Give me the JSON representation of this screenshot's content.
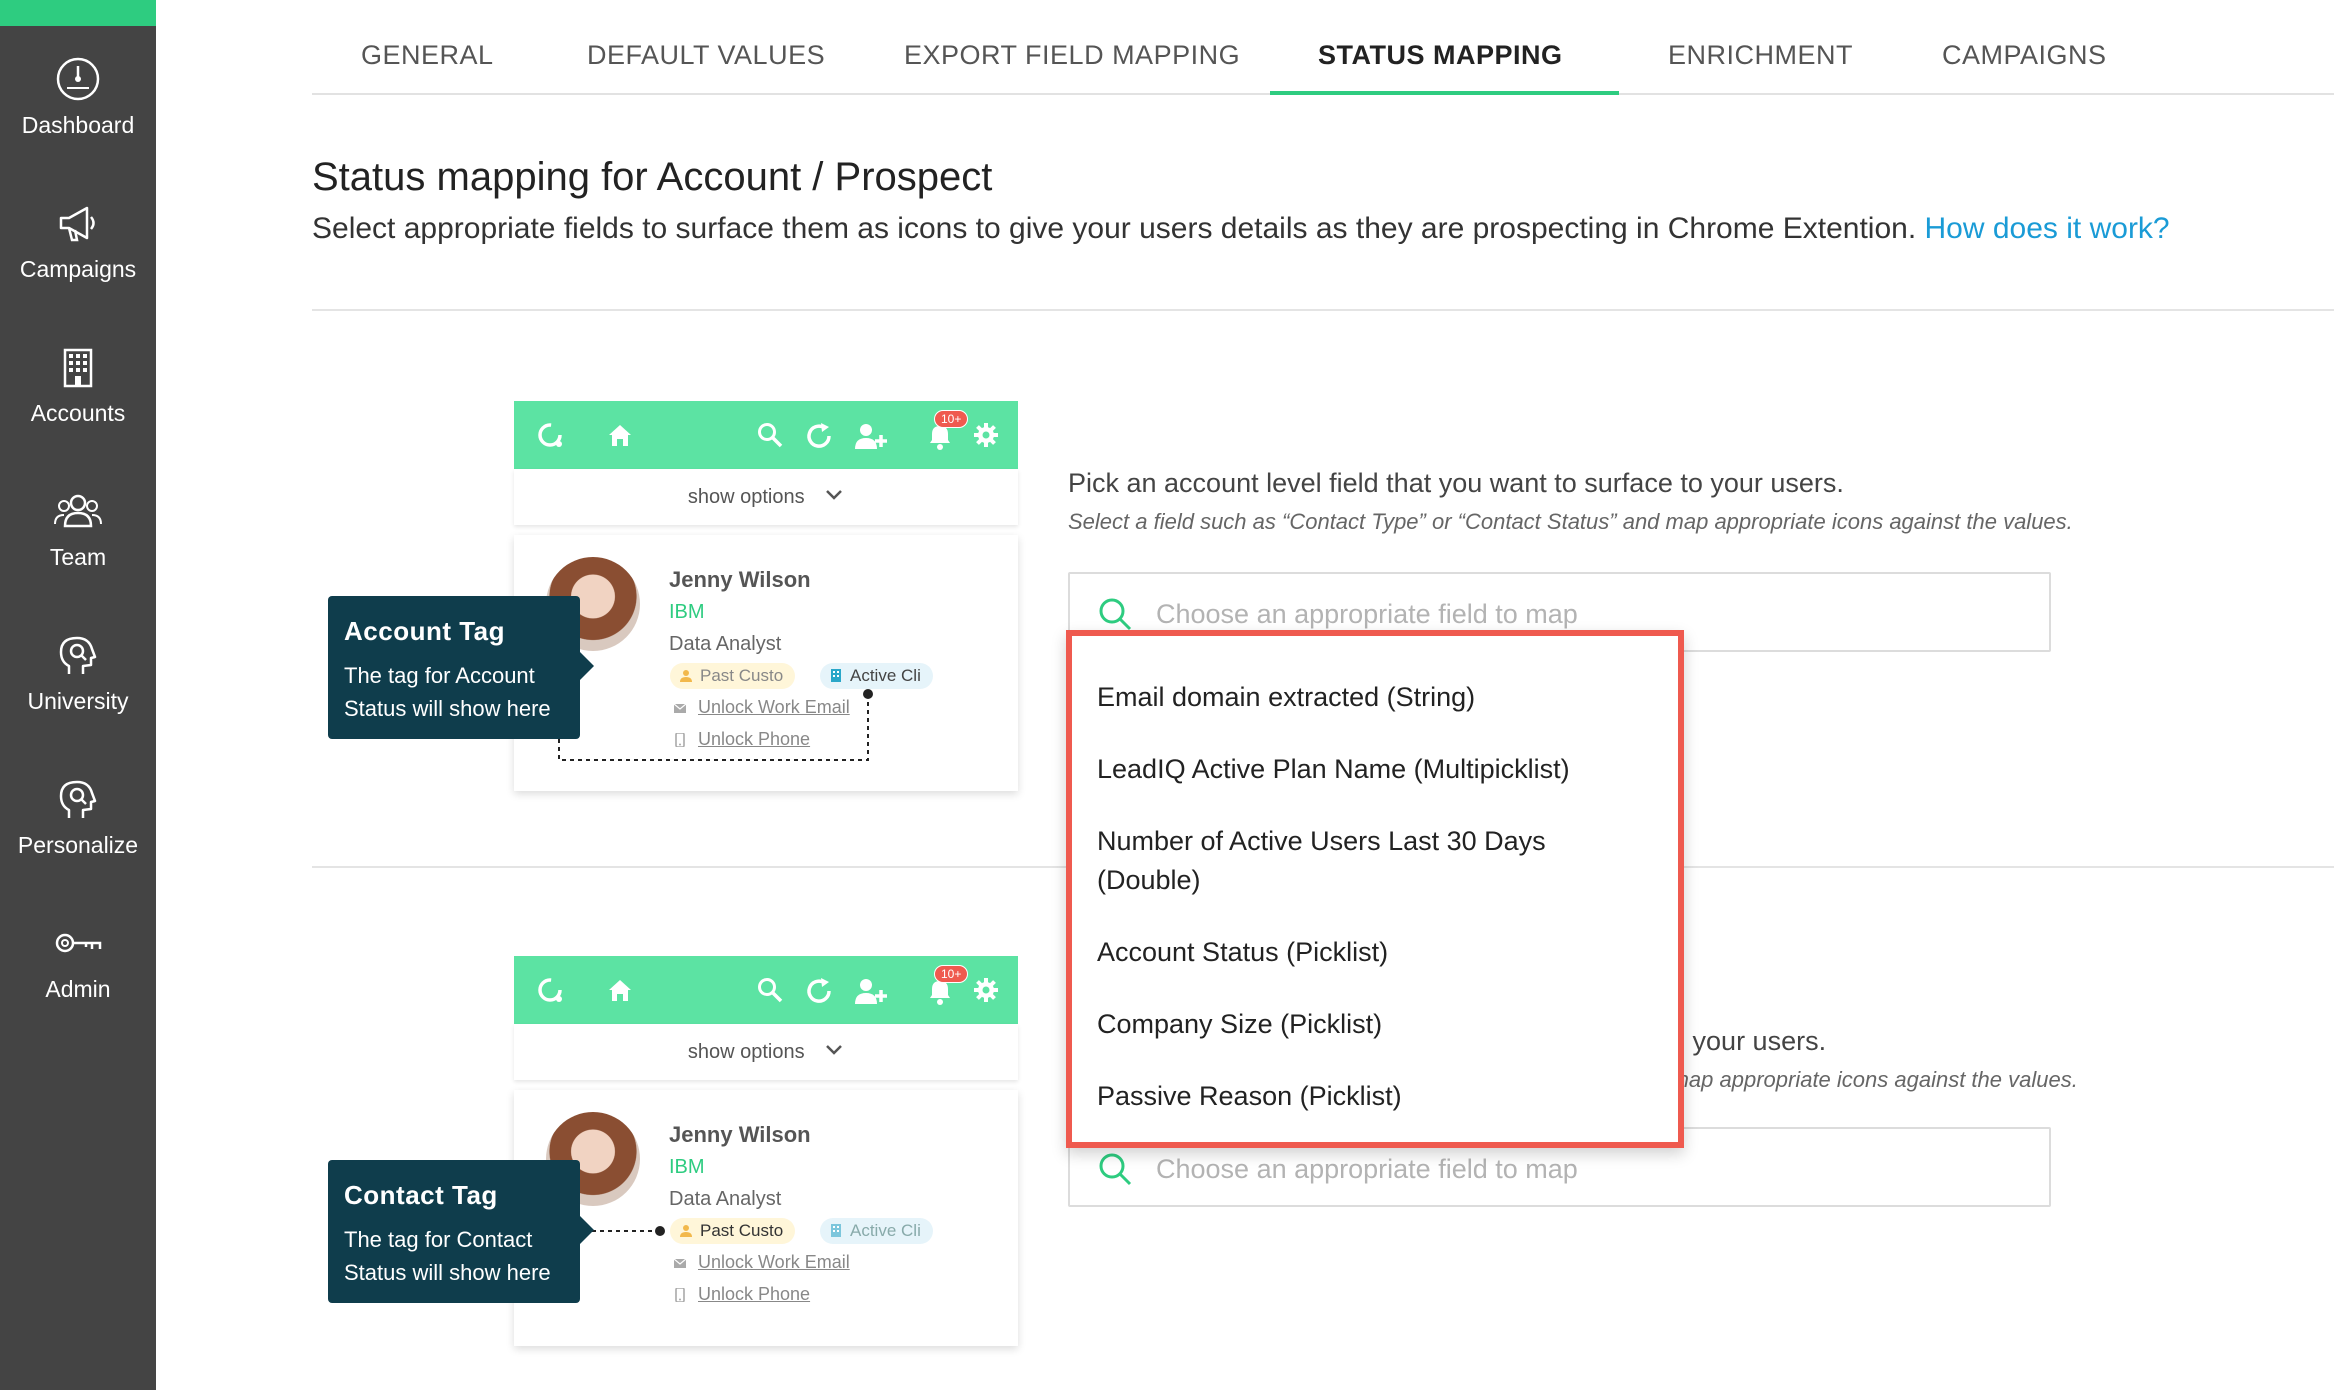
{
  "sidebar": {
    "items": [
      {
        "label": "Dashboard",
        "icon": "dashboard-gauge-icon"
      },
      {
        "label": "Campaigns",
        "icon": "megaphone-icon"
      },
      {
        "label": "Accounts",
        "icon": "building-icon"
      },
      {
        "label": "Team",
        "icon": "people-icon"
      },
      {
        "label": "University",
        "icon": "head-search-icon"
      },
      {
        "label": "Personalize",
        "icon": "head-search-icon"
      },
      {
        "label": "Admin",
        "icon": "key-icon"
      }
    ]
  },
  "tabs": [
    {
      "label": "GENERAL"
    },
    {
      "label": "DEFAULT VALUES"
    },
    {
      "label": "EXPORT FIELD MAPPING"
    },
    {
      "label": "STATUS MAPPING",
      "active": true
    },
    {
      "label": "ENRICHMENT"
    },
    {
      "label": "CAMPAIGNS"
    }
  ],
  "page": {
    "title": "Status mapping for Account / Prospect",
    "description": "Select appropriate fields to surface them as icons to give your users details as they are prospecting in Chrome Extention.",
    "help_link": "How does it work?"
  },
  "preview": {
    "show_options": "show options",
    "badge": "10+",
    "name": "Jenny Wilson",
    "company": "IBM",
    "job_title": "Data Analyst",
    "tag_past": "Past Custo",
    "tag_active": "Active Cli",
    "unlock_email": "Unlock Work Email",
    "unlock_phone": "Unlock Phone"
  },
  "account_section": {
    "callout_title": "Account Tag",
    "callout_body": "The tag for Account Status will show here",
    "instruction": "Pick an account level field that you want to surface to your users.",
    "hint": "Select a field such as “Contact Type” or “Contact Status” and map appropriate icons against the values.",
    "placeholder": "Choose an appropriate field to map"
  },
  "contact_section": {
    "callout_title": "Contact Tag",
    "callout_body": "The tag for Contact Status will show here",
    "instruction_partial": "e to your users.",
    "hint_partial": "nd map appropriate icons against the values.",
    "placeholder": "Choose an appropriate field to map"
  },
  "dropdown": {
    "options": [
      "Email domain extracted (String)",
      "LeadIQ Active Plan Name (Multipicklist)",
      "Number of Active Users Last 30 Days (Double)",
      "Account Status (Picklist)",
      "Company Size (Picklist)",
      "Passive Reason (Picklist)"
    ]
  },
  "colors": {
    "accent": "#2ecc80",
    "sidebar": "#444444",
    "extension_bar": "#5ce3a3",
    "callout": "#0f3d4c",
    "link": "#1a9bd6",
    "dropdown_border": "#ef5a4f"
  }
}
